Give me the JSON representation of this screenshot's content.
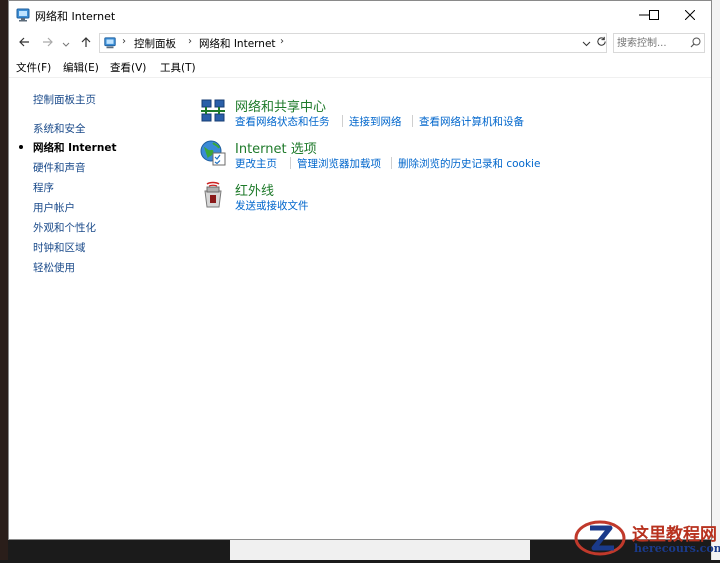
{
  "window": {
    "title": "网络和 Internet",
    "minimize_icon": "minimize-icon",
    "maximize_icon": "maximize-icon",
    "close_icon": "close-icon"
  },
  "address_bar": {
    "breadcrumbs": [
      "控制面板",
      "网络和 Internet"
    ],
    "search_placeholder": "搜索控制..."
  },
  "menu": [
    "文件(F)",
    "编辑(E)",
    "查看(V)",
    "工具(T)"
  ],
  "sidebar": {
    "home": "控制面板主页",
    "items": [
      {
        "label": "系统和安全",
        "current": false
      },
      {
        "label": "网络和 Internet",
        "current": true
      },
      {
        "label": "硬件和声音",
        "current": false
      },
      {
        "label": "程序",
        "current": false
      },
      {
        "label": "用户帐户",
        "current": false
      },
      {
        "label": "外观和个性化",
        "current": false
      },
      {
        "label": "时钟和区域",
        "current": false
      },
      {
        "label": "轻松使用",
        "current": false
      }
    ]
  },
  "categories": [
    {
      "icon": "network-sharing-center-icon",
      "title": "网络和共享中心",
      "links": [
        "查看网络状态和任务",
        "连接到网络",
        "查看网络计算机和设备"
      ]
    },
    {
      "icon": "internet-options-icon",
      "title": "Internet 选项",
      "links": [
        "更改主页",
        "管理浏览器加载项",
        "删除浏览的历史记录和 cookie"
      ]
    },
    {
      "icon": "infrared-icon",
      "title": "红外线",
      "links": [
        "发送或接收文件"
      ]
    }
  ],
  "watermark": {
    "name": "这里教程网",
    "url": "herecours.com"
  },
  "colors": {
    "category_title": "#1e7a2a",
    "link": "#0066cc",
    "sidebar_link": "#1a4a8a"
  }
}
